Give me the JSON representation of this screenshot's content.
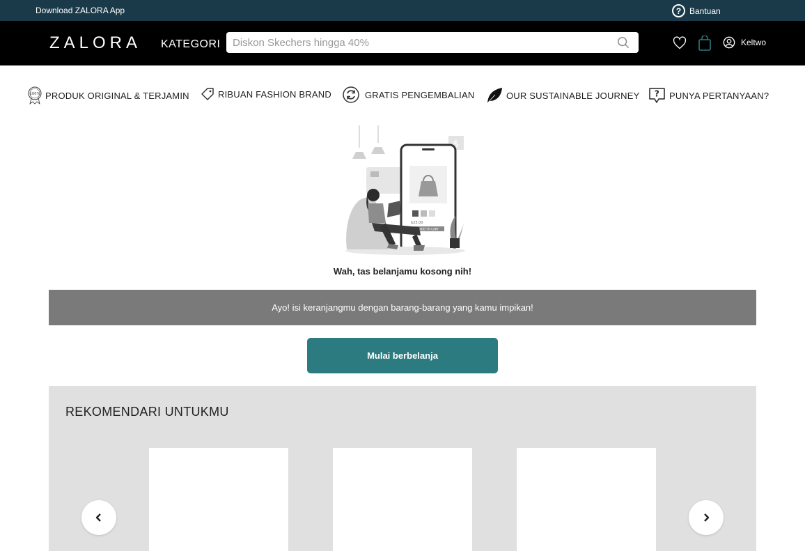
{
  "topbar": {
    "download_label": "Download ZALORA App",
    "help_label": "Bantuan",
    "help_glyph": "?"
  },
  "header": {
    "logo": "ZALORA",
    "category_label": "KATEGORI",
    "search_placeholder": "Diskon Skechers hingga 40%",
    "user_name": "Keltwo",
    "icons": [
      "search-icon",
      "heart-icon",
      "bag-icon",
      "user-icon"
    ]
  },
  "values": [
    {
      "label": "PRODUK ORIGINAL & TERJAMIN",
      "badge": "100%",
      "icon": "original-badge-icon"
    },
    {
      "label": "RIBUAN FASHION BRAND",
      "icon": "tag-icon"
    },
    {
      "label": "GRATIS  PENGEMBALIAN",
      "icon": "return-icon"
    },
    {
      "label": "OUR SUSTAINABLE JOURNEY",
      "icon": "leaf-icon"
    },
    {
      "label": "PUNYA PERTANYAAN?",
      "icon": "question-bubble-icon"
    }
  ],
  "illustration": {
    "price": "$23.00",
    "cart_button": "ADD TO CART",
    "dollar": "$"
  },
  "empty_cart": {
    "title": "Wah, tas belanjamu kosong nih!",
    "message": "Ayo! isi keranjangmu dengan barang-barang yang kamu impikan!",
    "cta_label": "Mulai berbelanja"
  },
  "recommendations": {
    "title": "REKOMENDARI UNTUKMU",
    "prev_glyph": "‹",
    "next_glyph": "›"
  },
  "colors": {
    "topbar": "#1a3a4a",
    "header": "#000000",
    "cta": "#2b7b80",
    "info_bar": "#7a7a7a",
    "reco_bg": "#e0e0e0"
  }
}
